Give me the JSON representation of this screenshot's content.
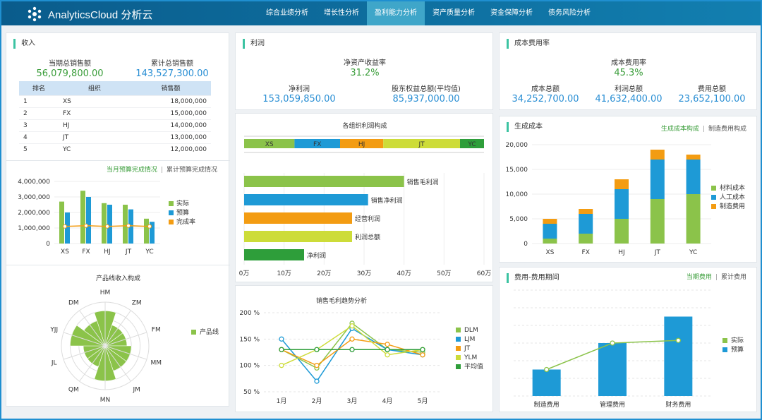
{
  "app": {
    "brand": "AnalyticsCloud 分析云"
  },
  "nav": [
    {
      "label": "综合业绩分析"
    },
    {
      "label": "增长性分析"
    },
    {
      "label": "盈利能力分析",
      "active": true
    },
    {
      "label": "资产质量分析"
    },
    {
      "label": "资金保障分析"
    },
    {
      "label": "债务风险分析"
    }
  ],
  "colors": {
    "green": "#8bc34a",
    "blue": "#1e9ad6",
    "orange": "#f39c12",
    "lime": "#cddc39",
    "dark_green": "#2e9e3a",
    "accent": "#3cc3a2"
  },
  "income": {
    "title": "收入",
    "current_label": "当期总销售额",
    "current_value": "56,079,800.00",
    "total_label": "累计总销售额",
    "total_value": "143,527,300.00",
    "table": {
      "headers": [
        "排名",
        "组织",
        "销售额"
      ],
      "rows": [
        [
          "1",
          "XS",
          "18,000,000"
        ],
        [
          "2",
          "FX",
          "15,000,000"
        ],
        [
          "3",
          "HJ",
          "14,000,000"
        ],
        [
          "4",
          "JT",
          "13,000,000"
        ],
        [
          "5",
          "YC",
          "12,000,000"
        ]
      ]
    },
    "toggle": {
      "on": "当月预算完成情况",
      "off": "累计预算完成情况"
    }
  },
  "profit": {
    "title": "利润",
    "roe_label": "净资产收益率",
    "roe_value": "31.2%",
    "net_label": "净利润",
    "net_value": "153,059,850.00",
    "equity_label": "股东权益总额(平均值)",
    "equity_value": "85,937,000.00",
    "org_title": "各组织利润构成",
    "trend_title": "销售毛利趋势分析"
  },
  "cost": {
    "title": "成本费用率",
    "rate_label": "成本费用率",
    "rate_value": "45.3%",
    "cost_label": "成本总额",
    "cost_value": "34,252,700.00",
    "profit_label": "利润总额",
    "profit_value": "41,632,400.00",
    "fee_label": "费用总额",
    "fee_value": "23,652,100.00"
  },
  "gen_cost": {
    "title": "生成成本",
    "toggle": {
      "on": "生成成本构成",
      "off": "制造费用构成"
    }
  },
  "expense": {
    "title": "费用-费用期间",
    "toggle": {
      "on": "当期费用",
      "off": "累计费用"
    }
  },
  "chart_data": [
    {
      "id": "budget",
      "type": "bar",
      "categories": [
        "XS",
        "FX",
        "HJ",
        "JT",
        "YC"
      ],
      "series": [
        {
          "name": "实际",
          "values": [
            2700000,
            3400000,
            2600000,
            2500000,
            1600000
          ]
        },
        {
          "name": "预算",
          "values": [
            2000000,
            3000000,
            2500000,
            2200000,
            1400000
          ]
        },
        {
          "name": "完成率",
          "values": [
            1100000,
            1150000,
            1100000,
            1150000,
            1100000
          ]
        }
      ],
      "yticks": [
        "0",
        "1,000,000",
        "2,000,000",
        "3,000,000",
        "4,000,000"
      ],
      "ylim": [
        0,
        4000000
      ]
    },
    {
      "id": "radar",
      "type": "bar",
      "title": "产品线收入构成",
      "categories": [
        "HM",
        "ZM",
        "FM",
        "MM",
        "JM",
        "MN",
        "QM",
        "JL",
        "YJJ",
        "DM"
      ],
      "values": [
        4,
        2.5,
        2.5,
        3,
        3,
        4,
        2.5,
        2.5,
        4,
        3
      ],
      "series_name": "产品线",
      "rmax": 5
    },
    {
      "id": "stack",
      "type": "bar",
      "categories": [
        "XS",
        "FX",
        "HJ",
        "JT",
        "YC"
      ],
      "series": [
        {
          "name": "材料成本",
          "values": [
            1000,
            2000,
            5000,
            9000,
            10000
          ]
        },
        {
          "name": "人工成本",
          "values": [
            3000,
            4000,
            6000,
            8000,
            7000
          ]
        },
        {
          "name": "制造费用",
          "values": [
            1000,
            1000,
            2000,
            2000,
            1000
          ]
        }
      ],
      "yticks": [
        "0",
        "5,000",
        "10,000",
        "15,000",
        "20,000"
      ],
      "ylim": [
        0,
        20000
      ]
    },
    {
      "id": "orgbar",
      "type": "bar",
      "categories": [
        "XS",
        "FX",
        "HJ",
        "JT",
        "YC"
      ],
      "values": [
        21,
        19,
        18,
        32,
        10
      ]
    },
    {
      "id": "hbar",
      "type": "bar",
      "categories": [
        "销售毛利润",
        "销售净利润",
        "经营利润",
        "利润总额",
        "净利润"
      ],
      "values": [
        400000,
        310000,
        270000,
        270000,
        150000
      ],
      "xticks": [
        "0万",
        "10万",
        "20万",
        "30万",
        "40万",
        "50万",
        "60万"
      ],
      "xlim": [
        0,
        600000
      ]
    },
    {
      "id": "trend",
      "type": "line",
      "categories": [
        "1月",
        "2月",
        "3月",
        "4月",
        "5月"
      ],
      "series": [
        {
          "name": "DLM",
          "values": [
            130,
            95,
            180,
            130,
            125
          ]
        },
        {
          "name": "LJM",
          "values": [
            150,
            70,
            170,
            130,
            120
          ]
        },
        {
          "name": "JT",
          "values": [
            130,
            100,
            150,
            140,
            120
          ]
        },
        {
          "name": "YLM",
          "values": [
            100,
            130,
            175,
            120,
            130
          ]
        },
        {
          "name": "平均值",
          "values": [
            130,
            130,
            130,
            130,
            130
          ]
        }
      ],
      "yticks": [
        "50 %",
        "100 %",
        "150 %",
        "200 %"
      ],
      "ylim": [
        50,
        200
      ]
    },
    {
      "id": "expense",
      "type": "bar",
      "categories": [
        "制造费用",
        "管理费用",
        "财务费用"
      ],
      "series": [
        {
          "name": "实际",
          "values": [
            2.5,
            5,
            5.25
          ]
        },
        {
          "name": "预算",
          "values": [
            2.5,
            5,
            7.5
          ]
        }
      ],
      "ylim": [
        0,
        10
      ]
    }
  ]
}
